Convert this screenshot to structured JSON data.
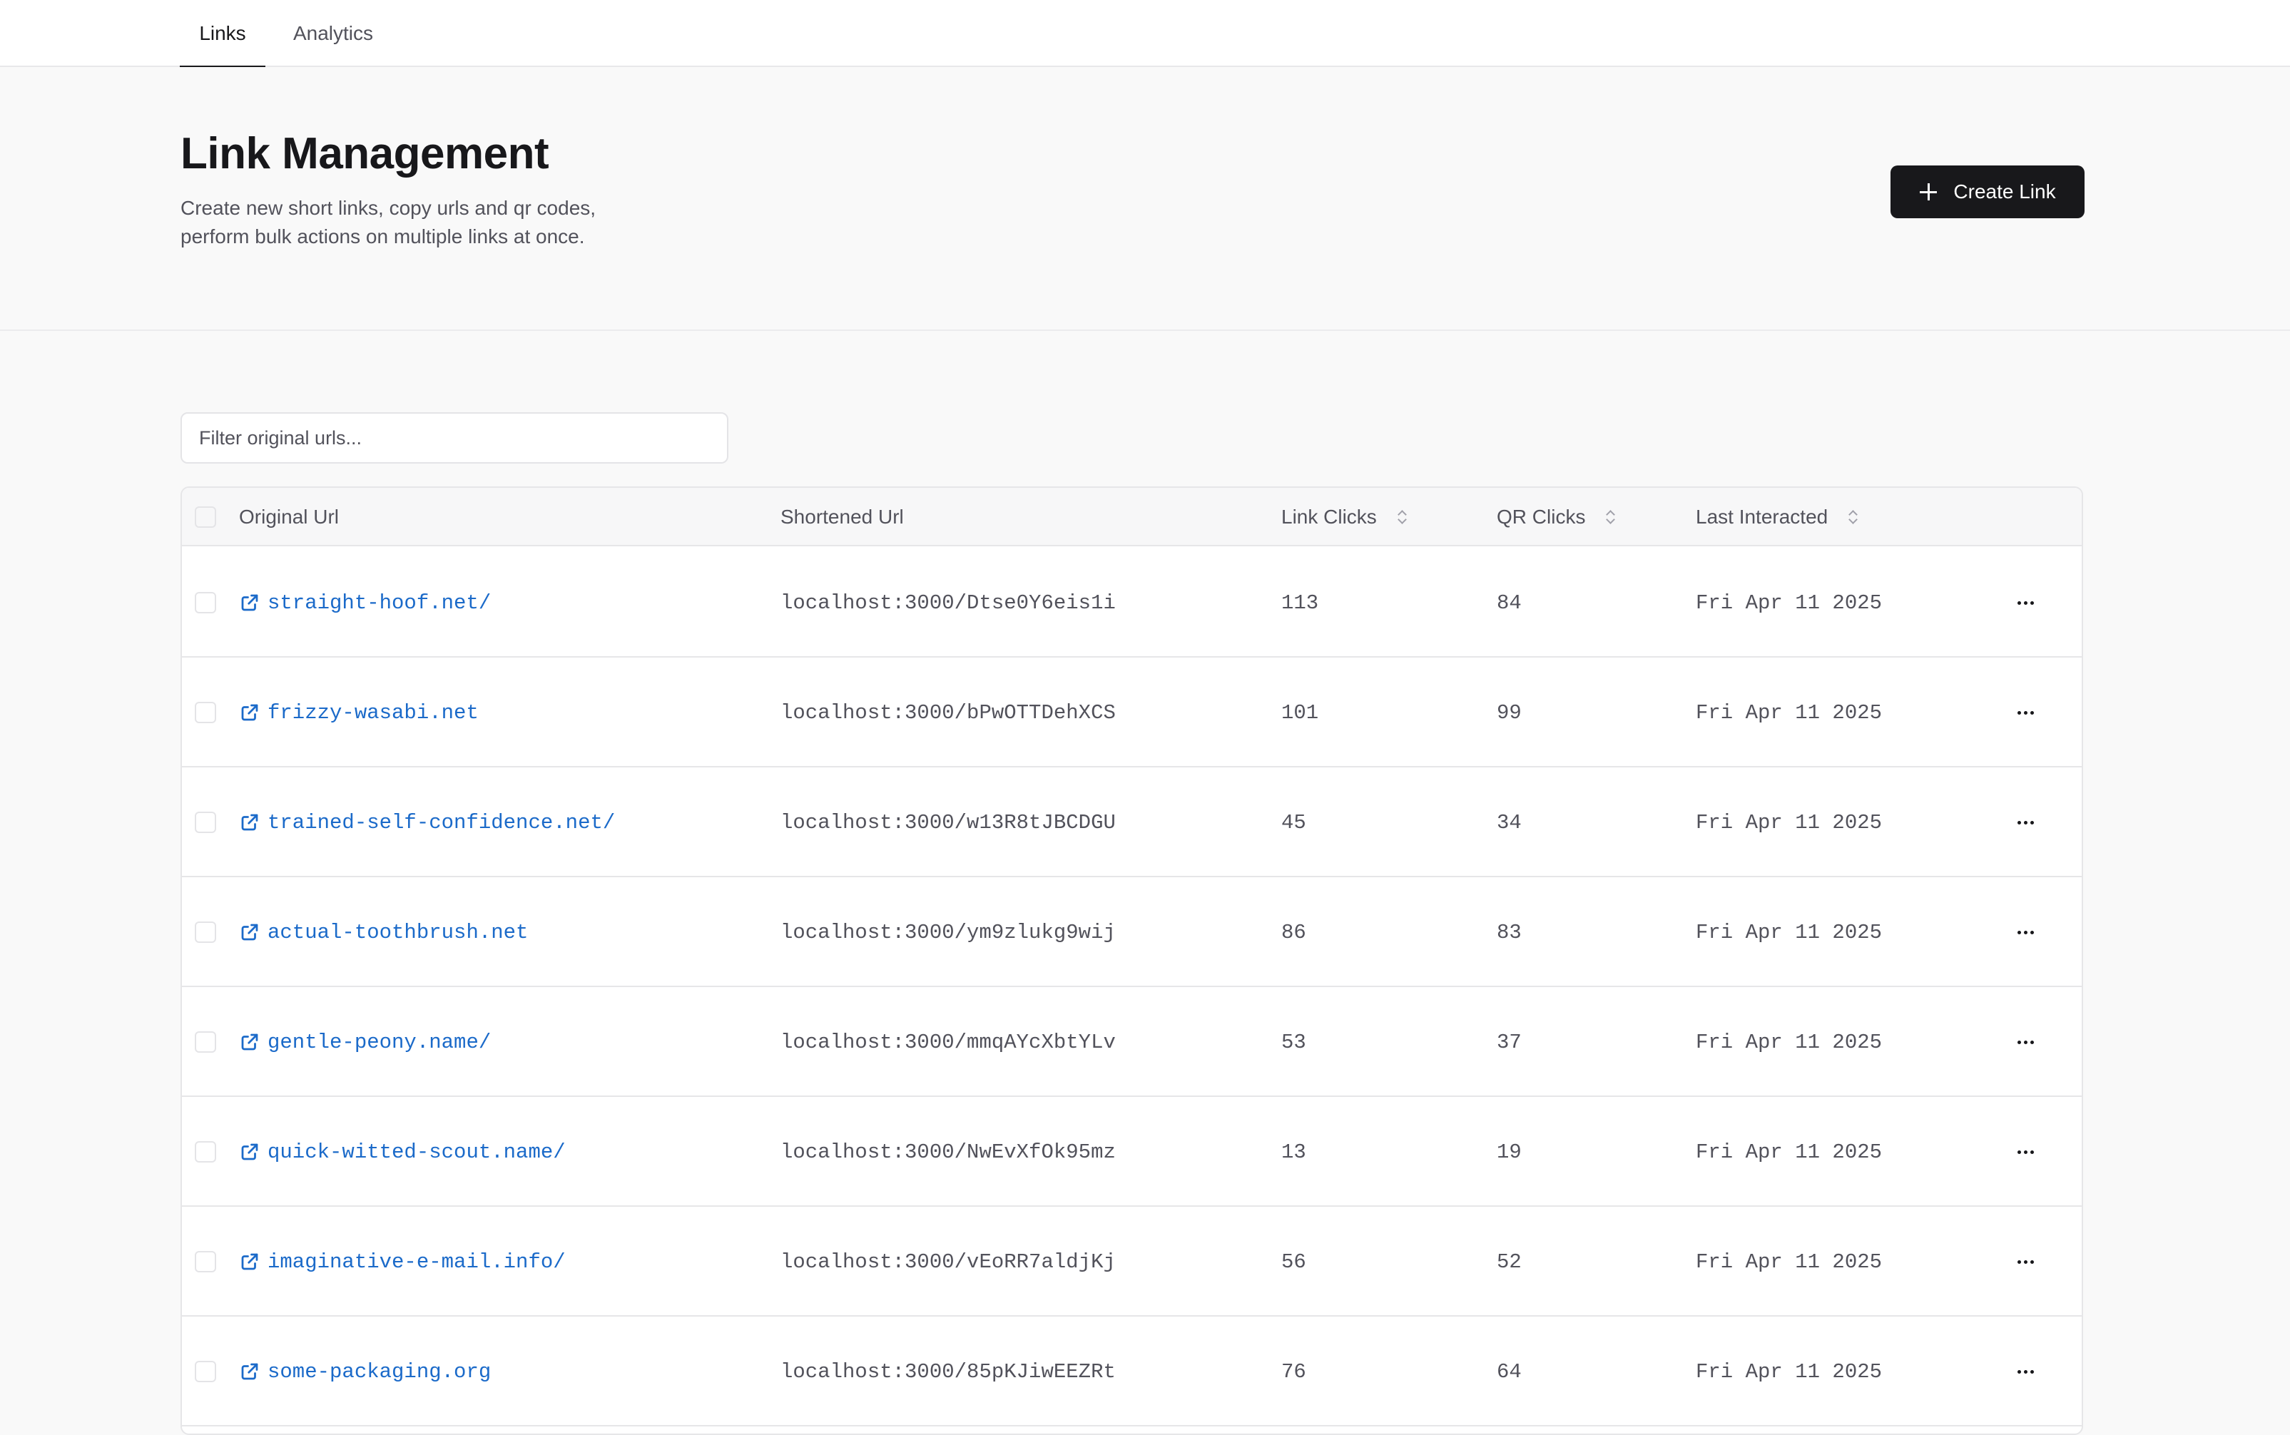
{
  "nav": {
    "tabs": [
      {
        "label": "Links",
        "active": true
      },
      {
        "label": "Analytics",
        "active": false
      }
    ]
  },
  "header": {
    "title": "Link Management",
    "description_line1": "Create new short links, copy urls and qr codes,",
    "description_line2": "perform bulk actions on multiple links at once.",
    "create_button_label": "Create Link",
    "create_button_icon": "plus-icon"
  },
  "filter": {
    "placeholder": "Filter original urls...",
    "value": ""
  },
  "table": {
    "columns": {
      "original_url": "Original Url",
      "shortened_url": "Shortened Url",
      "link_clicks": "Link Clicks",
      "qr_clicks": "QR Clicks",
      "last_interacted": "Last Interacted"
    },
    "rows": [
      {
        "original_url": "straight-hoof.net/",
        "shortened_url": "localhost:3000/Dtse0Y6eis1i",
        "link_clicks": "113",
        "qr_clicks": "84",
        "last_interacted": "Fri Apr 11 2025"
      },
      {
        "original_url": "frizzy-wasabi.net",
        "shortened_url": "localhost:3000/bPwOTTDehXCS",
        "link_clicks": "101",
        "qr_clicks": "99",
        "last_interacted": "Fri Apr 11 2025"
      },
      {
        "original_url": "trained-self-confidence.net/",
        "shortened_url": "localhost:3000/w13R8tJBCDGU",
        "link_clicks": "45",
        "qr_clicks": "34",
        "last_interacted": "Fri Apr 11 2025"
      },
      {
        "original_url": "actual-toothbrush.net",
        "shortened_url": "localhost:3000/ym9zlukg9wij",
        "link_clicks": "86",
        "qr_clicks": "83",
        "last_interacted": "Fri Apr 11 2025"
      },
      {
        "original_url": "gentle-peony.name/",
        "shortened_url": "localhost:3000/mmqAYcXbtYLv",
        "link_clicks": "53",
        "qr_clicks": "37",
        "last_interacted": "Fri Apr 11 2025"
      },
      {
        "original_url": "quick-witted-scout.name/",
        "shortened_url": "localhost:3000/NwEvXfOk95mz",
        "link_clicks": "13",
        "qr_clicks": "19",
        "last_interacted": "Fri Apr 11 2025"
      },
      {
        "original_url": "imaginative-e-mail.info/",
        "shortened_url": "localhost:3000/vEoRR7aldjKj",
        "link_clicks": "56",
        "qr_clicks": "52",
        "last_interacted": "Fri Apr 11 2025"
      },
      {
        "original_url": "some-packaging.org",
        "shortened_url": "localhost:3000/85pKJiwEEZRt",
        "link_clicks": "76",
        "qr_clicks": "64",
        "last_interacted": "Fri Apr 11 2025"
      }
    ]
  },
  "colors": {
    "link": "#1b6ac9",
    "primary": "#18181b",
    "muted_text": "#52525b",
    "border": "#e6e6e8",
    "page_background": "#f9f9f9"
  },
  "icons": {
    "row_link_icon": "external-link-icon",
    "row_action_icon": "more-horizontal-icon",
    "sort_icon": "sort-arrows-icon"
  }
}
